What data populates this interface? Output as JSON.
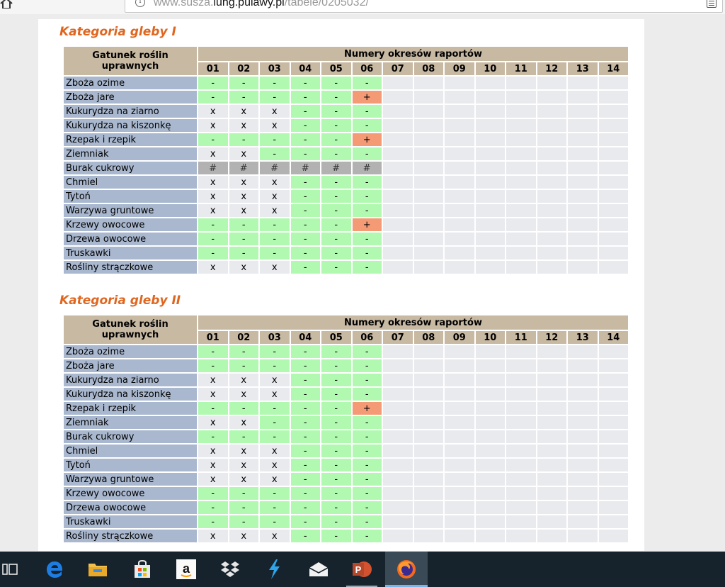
{
  "browser": {
    "url_prefix": "www.susza.",
    "url_domain": "iung.pulawy.pl",
    "url_path": "/tabele/0205032/"
  },
  "header_labels": {
    "crop_column": "Gatunek roślin uprawnych",
    "periods": "Numery okresów raportów",
    "period_numbers": [
      "01",
      "02",
      "03",
      "04",
      "05",
      "06",
      "07",
      "08",
      "09",
      "10",
      "11",
      "12",
      "13",
      "14"
    ]
  },
  "sections": [
    {
      "title": "Kategoria gleby I",
      "rows": [
        {
          "crop": "Zboża ozime",
          "values": [
            "-",
            "-",
            "-",
            "-",
            "-",
            "-",
            "",
            "",
            "",
            "",
            "",
            "",
            "",
            ""
          ]
        },
        {
          "crop": "Zboża jare",
          "values": [
            "-",
            "-",
            "-",
            "-",
            "-",
            "+",
            "",
            "",
            "",
            "",
            "",
            "",
            "",
            ""
          ]
        },
        {
          "crop": "Kukurydza na ziarno",
          "values": [
            "x",
            "x",
            "x",
            "-",
            "-",
            "-",
            "",
            "",
            "",
            "",
            "",
            "",
            "",
            ""
          ]
        },
        {
          "crop": "Kukurydza na kiszonkę",
          "values": [
            "x",
            "x",
            "x",
            "-",
            "-",
            "-",
            "",
            "",
            "",
            "",
            "",
            "",
            "",
            ""
          ]
        },
        {
          "crop": "Rzepak i rzepik",
          "values": [
            "-",
            "-",
            "-",
            "-",
            "-",
            "+",
            "",
            "",
            "",
            "",
            "",
            "",
            "",
            ""
          ]
        },
        {
          "crop": "Ziemniak",
          "values": [
            "x",
            "x",
            "-",
            "-",
            "-",
            "-",
            "",
            "",
            "",
            "",
            "",
            "",
            "",
            ""
          ]
        },
        {
          "crop": "Burak cukrowy",
          "values": [
            "#",
            "#",
            "#",
            "#",
            "#",
            "#",
            "",
            "",
            "",
            "",
            "",
            "",
            "",
            ""
          ]
        },
        {
          "crop": "Chmiel",
          "values": [
            "x",
            "x",
            "x",
            "-",
            "-",
            "-",
            "",
            "",
            "",
            "",
            "",
            "",
            "",
            ""
          ]
        },
        {
          "crop": "Tytoń",
          "values": [
            "x",
            "x",
            "x",
            "-",
            "-",
            "-",
            "",
            "",
            "",
            "",
            "",
            "",
            "",
            ""
          ]
        },
        {
          "crop": "Warzywa gruntowe",
          "values": [
            "x",
            "x",
            "x",
            "-",
            "-",
            "-",
            "",
            "",
            "",
            "",
            "",
            "",
            "",
            ""
          ]
        },
        {
          "crop": "Krzewy owocowe",
          "values": [
            "-",
            "-",
            "-",
            "-",
            "-",
            "+",
            "",
            "",
            "",
            "",
            "",
            "",
            "",
            ""
          ]
        },
        {
          "crop": "Drzewa owocowe",
          "values": [
            "-",
            "-",
            "-",
            "-",
            "-",
            "-",
            "",
            "",
            "",
            "",
            "",
            "",
            "",
            ""
          ]
        },
        {
          "crop": "Truskawki",
          "values": [
            "-",
            "-",
            "-",
            "-",
            "-",
            "-",
            "",
            "",
            "",
            "",
            "",
            "",
            "",
            ""
          ]
        },
        {
          "crop": "Rośliny strączkowe",
          "values": [
            "x",
            "x",
            "x",
            "-",
            "-",
            "-",
            "",
            "",
            "",
            "",
            "",
            "",
            "",
            ""
          ]
        }
      ]
    },
    {
      "title": "Kategoria gleby II",
      "rows": [
        {
          "crop": "Zboża ozime",
          "values": [
            "-",
            "-",
            "-",
            "-",
            "-",
            "-",
            "",
            "",
            "",
            "",
            "",
            "",
            "",
            ""
          ]
        },
        {
          "crop": "Zboża jare",
          "values": [
            "-",
            "-",
            "-",
            "-",
            "-",
            "-",
            "",
            "",
            "",
            "",
            "",
            "",
            "",
            ""
          ]
        },
        {
          "crop": "Kukurydza na ziarno",
          "values": [
            "x",
            "x",
            "x",
            "-",
            "-",
            "-",
            "",
            "",
            "",
            "",
            "",
            "",
            "",
            ""
          ]
        },
        {
          "crop": "Kukurydza na kiszonkę",
          "values": [
            "x",
            "x",
            "x",
            "-",
            "-",
            "-",
            "",
            "",
            "",
            "",
            "",
            "",
            "",
            ""
          ]
        },
        {
          "crop": "Rzepak i rzepik",
          "values": [
            "-",
            "-",
            "-",
            "-",
            "-",
            "+",
            "",
            "",
            "",
            "",
            "",
            "",
            "",
            ""
          ]
        },
        {
          "crop": "Ziemniak",
          "values": [
            "x",
            "x",
            "-",
            "-",
            "-",
            "-",
            "",
            "",
            "",
            "",
            "",
            "",
            "",
            ""
          ]
        },
        {
          "crop": "Burak cukrowy",
          "values": [
            "-",
            "-",
            "-",
            "-",
            "-",
            "-",
            "",
            "",
            "",
            "",
            "",
            "",
            "",
            ""
          ]
        },
        {
          "crop": "Chmiel",
          "values": [
            "x",
            "x",
            "x",
            "-",
            "-",
            "-",
            "",
            "",
            "",
            "",
            "",
            "",
            "",
            ""
          ]
        },
        {
          "crop": "Tytoń",
          "values": [
            "x",
            "x",
            "x",
            "-",
            "-",
            "-",
            "",
            "",
            "",
            "",
            "",
            "",
            "",
            ""
          ]
        },
        {
          "crop": "Warzywa gruntowe",
          "values": [
            "x",
            "x",
            "x",
            "-",
            "-",
            "-",
            "",
            "",
            "",
            "",
            "",
            "",
            "",
            ""
          ]
        },
        {
          "crop": "Krzewy owocowe",
          "values": [
            "-",
            "-",
            "-",
            "-",
            "-",
            "-",
            "",
            "",
            "",
            "",
            "",
            "",
            "",
            ""
          ]
        },
        {
          "crop": "Drzewa owocowe",
          "values": [
            "-",
            "-",
            "-",
            "-",
            "-",
            "-",
            "",
            "",
            "",
            "",
            "",
            "",
            "",
            ""
          ]
        },
        {
          "crop": "Truskawki",
          "values": [
            "-",
            "-",
            "-",
            "-",
            "-",
            "-",
            "",
            "",
            "",
            "",
            "",
            "",
            "",
            ""
          ]
        },
        {
          "crop": "Rośliny strączkowe",
          "values": [
            "x",
            "x",
            "x",
            "-",
            "-",
            "-",
            "",
            "",
            "",
            "",
            "",
            "",
            "",
            ""
          ]
        }
      ]
    }
  ],
  "cell_colors": {
    "dash": "#b1f9b1",
    "x": "#e8eaee",
    "plus": "#f49b76",
    "hash": "#b2b2b2",
    "empty": "#e8eaee",
    "crop_label": "#a9b8cf",
    "header": "#c8b9a3",
    "heading_text": "#e0661f"
  },
  "taskbar": {
    "items": [
      {
        "name": "task-view-icon"
      },
      {
        "name": "edge-icon"
      },
      {
        "name": "file-explorer-icon"
      },
      {
        "name": "store-icon"
      },
      {
        "name": "amazon-icon",
        "glyph": "a"
      },
      {
        "name": "dropbox-icon"
      },
      {
        "name": "lightning-app-icon"
      },
      {
        "name": "mail-icon"
      },
      {
        "name": "powerpoint-icon",
        "glyph": "P"
      },
      {
        "name": "firefox-icon"
      }
    ],
    "active": "firefox-icon",
    "running": "powerpoint-icon"
  }
}
